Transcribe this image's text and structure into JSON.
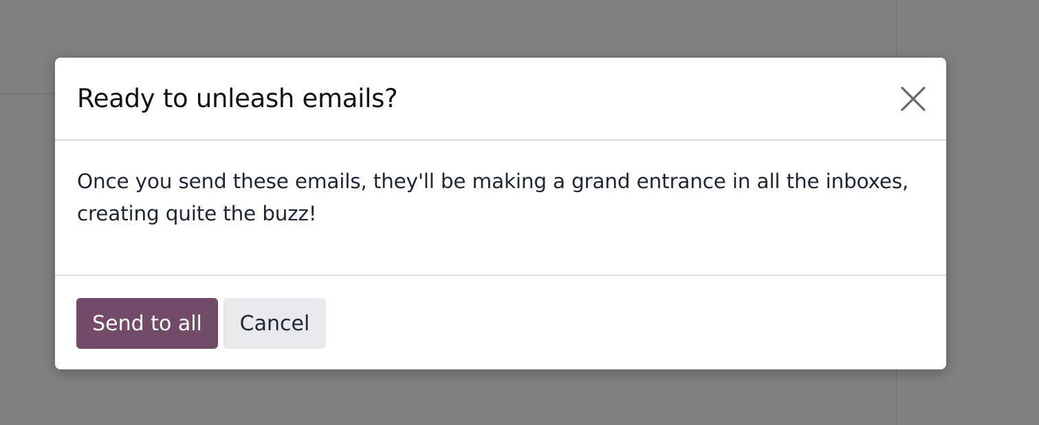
{
  "dialog": {
    "title": "Ready to unleash emails?",
    "message": "Once you send these emails, they'll be making a grand entrance in all the inboxes, creating quite the buzz!",
    "close_icon": "close-icon",
    "buttons": {
      "primary_label": "Send to all",
      "secondary_label": "Cancel"
    }
  },
  "colors": {
    "primary": "#714b67",
    "secondary": "#e7e9ed",
    "overlay": "#808080"
  }
}
